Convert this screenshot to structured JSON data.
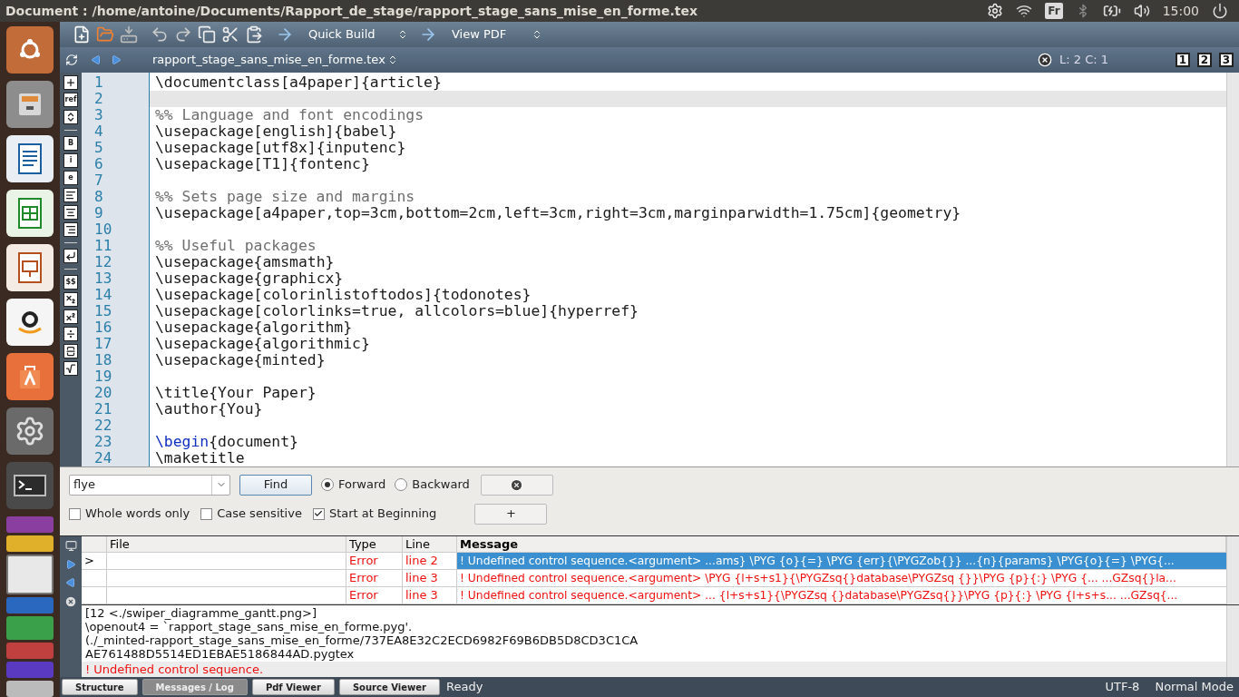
{
  "top_panel": {
    "window_title": "Document : /home/antoine/Documents/Rapport_de_stage/rapport_stage_sans_mise_en_forme.tex",
    "keyboard_layout": "Fr",
    "clock": "15:00"
  },
  "toolbar": {
    "build_select": "Quick Build",
    "view_select": "View PDF"
  },
  "file_bar": {
    "file_select": "rapport_stage_sans_mise_en_forme.tex",
    "cursor_position": "L: 2 C: 1",
    "view_buttons": [
      "1",
      "2",
      "3"
    ]
  },
  "symbol_bar": [
    {
      "kind": "insert"
    },
    {
      "kind": "text",
      "label": "ref"
    },
    {
      "kind": "font-size"
    },
    {
      "kind": "separator"
    },
    {
      "kind": "text",
      "label": "B"
    },
    {
      "kind": "text",
      "label": "i"
    },
    {
      "kind": "text",
      "label": "e"
    },
    {
      "kind": "align-left"
    },
    {
      "kind": "align-center"
    },
    {
      "kind": "align-right"
    },
    {
      "kind": "separator"
    },
    {
      "kind": "newline"
    },
    {
      "kind": "separator"
    },
    {
      "kind": "text",
      "label": "$$"
    },
    {
      "kind": "subscript"
    },
    {
      "kind": "superscript"
    },
    {
      "kind": "divide"
    },
    {
      "kind": "fraction"
    },
    {
      "kind": "sqrt"
    }
  ],
  "editor": {
    "lines": [
      {
        "number": "1",
        "kind": "command",
        "current": false,
        "cmd": "\\documentclass",
        "rest": "[a4paper]{article}"
      },
      {
        "number": "2",
        "kind": "blank",
        "current": true
      },
      {
        "number": "3",
        "kind": "comment",
        "current": false,
        "rest": "%% Language and font encodings"
      },
      {
        "number": "4",
        "kind": "command",
        "current": false,
        "cmd": "\\usepackage",
        "rest": "[english]{babel}"
      },
      {
        "number": "5",
        "kind": "command",
        "current": false,
        "cmd": "\\usepackage",
        "rest": "[utf8x]{inputenc}"
      },
      {
        "number": "6",
        "kind": "command",
        "current": false,
        "cmd": "\\usepackage",
        "rest": "[T1]{fontenc}"
      },
      {
        "number": "7",
        "kind": "blank",
        "current": false
      },
      {
        "number": "8",
        "kind": "comment",
        "current": false,
        "rest": "%% Sets page size and margins"
      },
      {
        "number": "9",
        "kind": "command",
        "current": false,
        "cmd": "\\usepackage",
        "rest": "[a4paper,top=3cm,bottom=2cm,left=3cm,right=3cm,marginparwidth=1.75cm]{geometry}"
      },
      {
        "number": "10",
        "kind": "blank",
        "current": false
      },
      {
        "number": "11",
        "kind": "comment",
        "current": false,
        "rest": "%% Useful packages"
      },
      {
        "number": "12",
        "kind": "command",
        "current": false,
        "cmd": "\\usepackage",
        "rest": "{amsmath}"
      },
      {
        "number": "13",
        "kind": "command",
        "current": false,
        "cmd": "\\usepackage",
        "rest": "{graphicx}"
      },
      {
        "number": "14",
        "kind": "command",
        "current": false,
        "cmd": "\\usepackage",
        "rest": "[colorinlistoftodos]{todonotes}"
      },
      {
        "number": "15",
        "kind": "command",
        "current": false,
        "cmd": "\\usepackage",
        "rest": "[colorlinks=true, allcolors=blue]{hyperref}"
      },
      {
        "number": "16",
        "kind": "command",
        "current": false,
        "cmd": "\\usepackage",
        "rest": "{algorithm}"
      },
      {
        "number": "17",
        "kind": "command",
        "current": false,
        "cmd": "\\usepackage",
        "rest": "{algorithmic}"
      },
      {
        "number": "18",
        "kind": "command",
        "current": false,
        "cmd": "\\usepackage",
        "rest": "{minted}"
      },
      {
        "number": "19",
        "kind": "blank",
        "current": false
      },
      {
        "number": "20",
        "kind": "command",
        "current": false,
        "cmd": "\\title",
        "rest": "{Your Paper}"
      },
      {
        "number": "21",
        "kind": "command",
        "current": false,
        "cmd": "\\author",
        "rest": "{You}"
      },
      {
        "number": "22",
        "kind": "blank",
        "current": false
      },
      {
        "number": "23",
        "kind": "environment",
        "current": false,
        "cmd": "\\begin",
        "rest": "{document}"
      },
      {
        "number": "24",
        "kind": "command",
        "current": false,
        "cmd": "\\maketitle"
      }
    ]
  },
  "find_panel": {
    "search_value": "flye",
    "find_button": "Find",
    "directions": [
      {
        "label": "Forward",
        "selected": true
      },
      {
        "label": "Backward",
        "selected": false
      }
    ],
    "options": [
      {
        "label": "Whole words only",
        "checked": false
      },
      {
        "label": "Case sensitive",
        "checked": false
      },
      {
        "label": "Start at Beginning",
        "checked": true
      }
    ],
    "more_button": "+"
  },
  "messages_table": {
    "columns": [
      "File",
      "Type",
      "Line",
      "Message"
    ],
    "rows": [
      {
        "marker": ">",
        "file": "",
        "type": "Error",
        "line": "line 2",
        "message": "! Undefined control sequence.<argument> ...ams} \\PYG {o}{=} \\PYG {err}{\\PYGZob{}} ...{n}{params} \\PYG{o}{=} \\PYG{...",
        "selected": true
      },
      {
        "file": "",
        "type": "Error",
        "line": "line 3",
        "message": "! Undefined control sequence.<argument> \\PYG {l+s+s1}{\\PYGZsq{}database\\PYGZsq {}}\\PYG {p}{:} \\PYG {... ...GZsq{}la...",
        "selected": false
      },
      {
        "file": "",
        "type": "Error",
        "line": "line 3",
        "message": "! Undefined control sequence.<argument> ... {l+s+s1}{\\PYGZsq {}database\\PYGZsq{}}\\PYG {p}{:} \\PYG {l+s+s... ...GZsq{...",
        "selected": false
      }
    ]
  },
  "log": [
    {
      "kind": "normal",
      "text": "[12 <./swiper_diagramme_gantt.png>]"
    },
    {
      "kind": "normal",
      "text": "\\openout4 = `rapport_stage_sans_mise_en_forme.pyg'."
    },
    {
      "kind": "normal",
      "text": "(./_minted-rapport_stage_sans_mise_en_forme/737EA8E32C2ECD6982F69B6DB5D8CD3C1CA"
    },
    {
      "kind": "normal",
      "text": "AE761488D5514ED1EBAE5186844AD.pygtex"
    },
    {
      "kind": "error",
      "text": "! Undefined control sequence."
    }
  ],
  "status_bar": {
    "tabs": [
      {
        "label": "Structure",
        "selected": false
      },
      {
        "label": "Messages / Log",
        "selected": true
      },
      {
        "label": "Pdf Viewer",
        "selected": false
      },
      {
        "label": "Source Viewer",
        "selected": false
      }
    ],
    "status": "Ready",
    "encoding": "UTF-8",
    "mode": "Normal Mode"
  }
}
